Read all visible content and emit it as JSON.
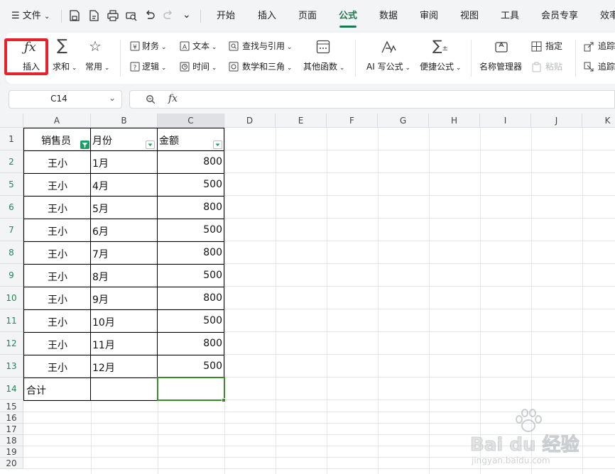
{
  "menubar": {
    "menu_label": "文件",
    "tabs": [
      "开始",
      "插入",
      "页面",
      "公式",
      "数据",
      "审阅",
      "视图",
      "工具",
      "会员专享",
      "效率"
    ],
    "active_tab": "公式"
  },
  "ribbon": {
    "insert_function": "插入",
    "autosum": "求和",
    "common": "常用",
    "financial": "财务",
    "text": "文本",
    "lookup": "查找与引用",
    "logical": "逻辑",
    "datetime": "时间",
    "math": "数学和三角",
    "other": "其他函数",
    "ai_formula": "AI 写公式",
    "quick_formula": "便捷公式",
    "name_manager": "名称管理器",
    "specify": "指定",
    "paste": "粘贴",
    "trace1": "追踪",
    "trace2": "追踪"
  },
  "formula_bar": {
    "name_box": "C14",
    "fx_label": "fx",
    "formula": ""
  },
  "grid": {
    "columns": [
      "A",
      "B",
      "C",
      "D",
      "E",
      "F",
      "G",
      "H",
      "I",
      "J",
      "K"
    ],
    "selected_column": "C",
    "row_numbers": [
      "1",
      "2",
      "5",
      "6",
      "7",
      "8",
      "9",
      "10",
      "11",
      "12",
      "13",
      "14",
      "15",
      "16",
      "17",
      "18",
      "19",
      "20"
    ],
    "header_row": [
      "销售员",
      "月份",
      "金额"
    ],
    "rows": [
      [
        "王小",
        "1月",
        "800"
      ],
      [
        "王小",
        "4月",
        "500"
      ],
      [
        "王小",
        "5月",
        "800"
      ],
      [
        "王小",
        "6月",
        "500"
      ],
      [
        "王小",
        "7月",
        "800"
      ],
      [
        "王小",
        "8月",
        "500"
      ],
      [
        "王小",
        "9月",
        "800"
      ],
      [
        "王小",
        "10月",
        "500"
      ],
      [
        "王小",
        "11月",
        "800"
      ],
      [
        "王小",
        "12月",
        "500"
      ]
    ],
    "total_label": "合计",
    "selected_cell": "C14"
  },
  "watermark": {
    "brand": "Bai du 经验",
    "domain": "jingyan.baidu.com"
  },
  "colors": {
    "accent_green": "#1b7a4b",
    "highlight_red": "#e5232a",
    "selection_green": "#3b8b2a",
    "filter_green": "#1b9e63"
  }
}
